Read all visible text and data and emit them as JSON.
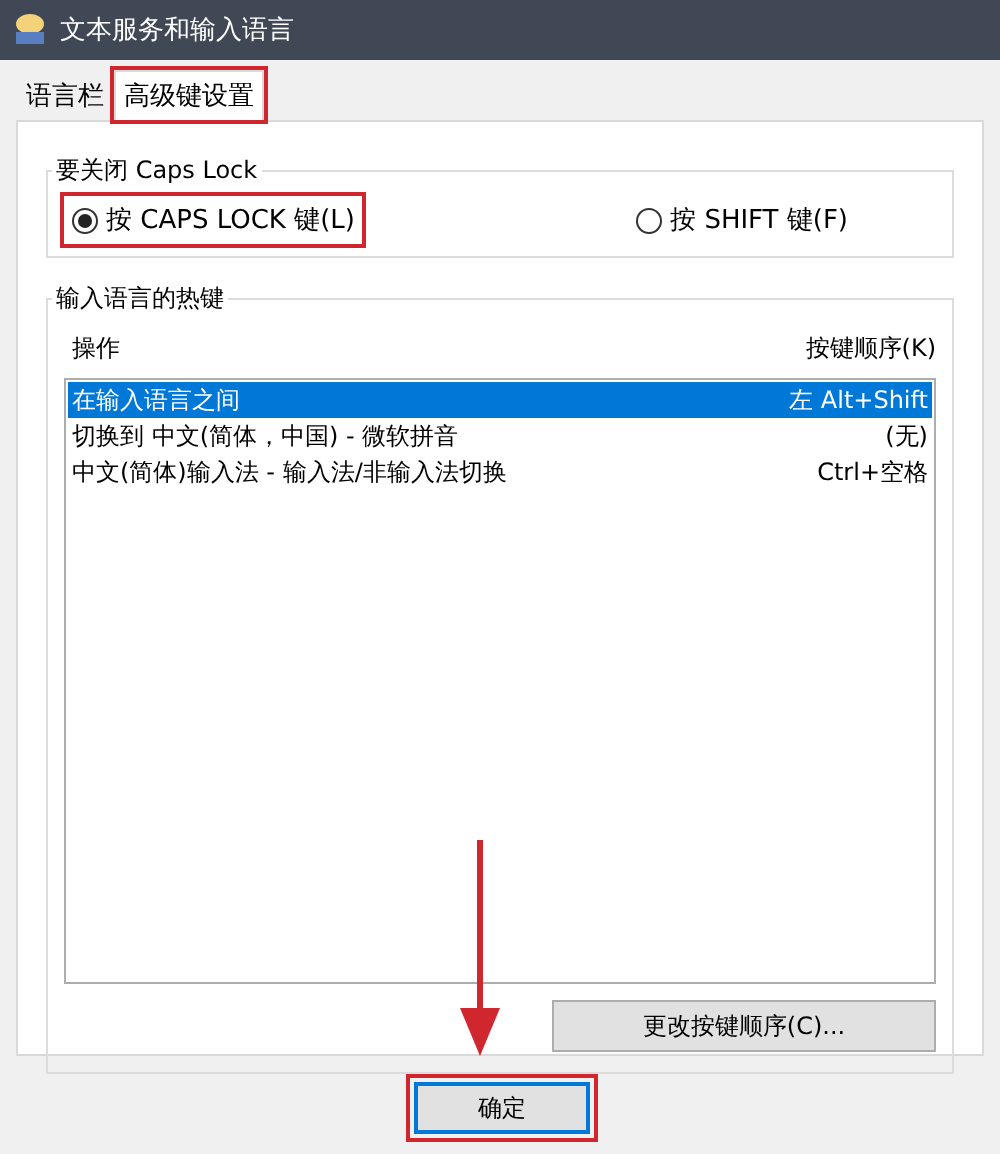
{
  "window": {
    "title": "文本服务和输入语言"
  },
  "tabs": [
    {
      "label": "语言栏",
      "selected": false,
      "highlighted": false
    },
    {
      "label": "高级键设置",
      "selected": true,
      "highlighted": true
    }
  ],
  "caps_lock_group": {
    "title": "要关闭 Caps Lock",
    "options": [
      {
        "label": "按 CAPS LOCK 键(L)",
        "selected": true,
        "highlighted": true
      },
      {
        "label": "按 SHIFT 键(F)",
        "selected": false,
        "highlighted": false
      }
    ]
  },
  "hotkeys_group": {
    "title": "输入语言的热键",
    "columns": [
      "操作",
      "按键顺序(K)"
    ],
    "rows": [
      {
        "action": "在输入语言之间",
        "keys": "左 Alt+Shift",
        "selected": true
      },
      {
        "action": "切换到 中文(简体，中国) - 微软拼音",
        "keys": "(无)",
        "selected": false
      },
      {
        "action": "中文(简体)输入法 - 输入法/非输入法切换",
        "keys": "Ctrl+空格",
        "selected": false
      }
    ],
    "change_button": "更改按键顺序(C)..."
  },
  "buttons": [
    {
      "label": "确定",
      "highlighted": true,
      "pointed_at": true
    }
  ]
}
